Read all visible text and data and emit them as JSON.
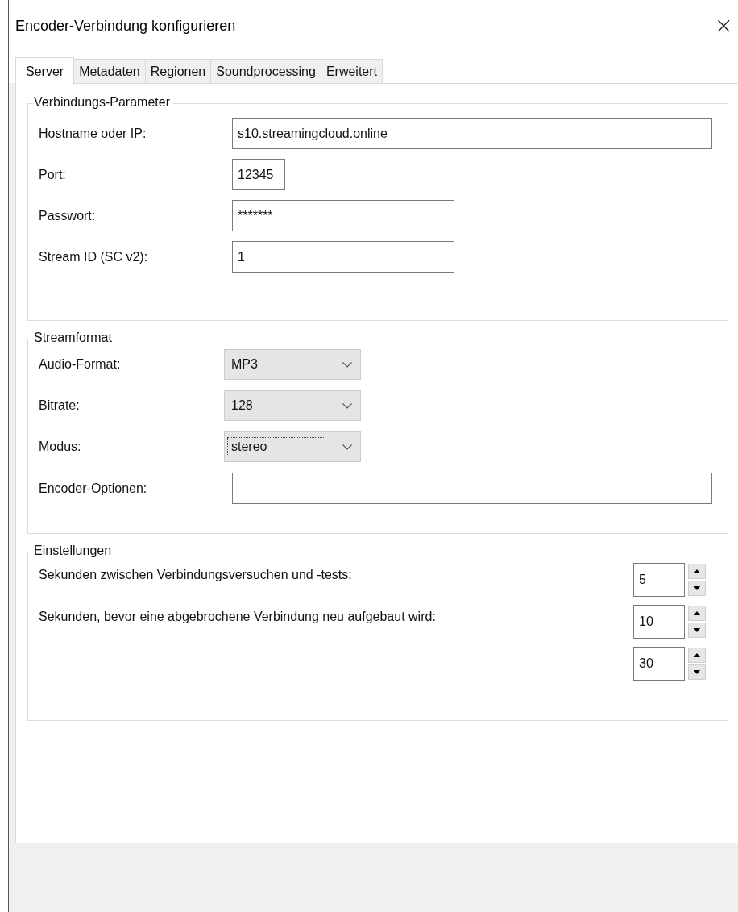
{
  "window": {
    "title": "Encoder-Verbindung konfigurieren",
    "close": "×"
  },
  "tabs": [
    {
      "label": "Server",
      "selected": true
    },
    {
      "label": "Metadaten",
      "selected": false
    },
    {
      "label": "Regionen",
      "selected": false
    },
    {
      "label": "Soundprocessing",
      "selected": false
    },
    {
      "label": "Erweitert",
      "selected": false
    }
  ],
  "groups": [
    {
      "title": "Verbindungs-Parameter",
      "rows": [
        {
          "kind": "wide",
          "label": "Hostname oder IP:",
          "value": "s10.streamingcloud.online"
        },
        {
          "kind": "short",
          "label": "Port:",
          "value": "12345"
        },
        {
          "kind": "text",
          "label": "Passwort:",
          "value": "*******"
        },
        {
          "kind": "text",
          "label": "Stream ID (SC v2):",
          "value": "1"
        }
      ]
    },
    {
      "title": "Streamformat",
      "rows": [
        {
          "kind": "combo",
          "label": "Audio-Format:",
          "value": "MP3",
          "focused": false
        },
        {
          "kind": "combo",
          "label": "Bitrate:",
          "value": "128",
          "focused": false
        },
        {
          "kind": "combo",
          "label": "Modus:",
          "value": "stereo",
          "focused": true
        },
        {
          "kind": "wide",
          "label": "Encoder-Optionen:"
        }
      ]
    },
    {
      "title": "Einstellungen",
      "rows": [
        {
          "kind": "spin",
          "label": "Sekunden zwischen Verbindungsversuchen und -tests:",
          "value": "5"
        },
        {
          "kind": "spin",
          "label": "Sekunden, bevor eine abgebrochene Verbindung neu aufgebaut wird:",
          "value": "10"
        },
        {
          "kind": "spin",
          "value": "30"
        }
      ]
    }
  ]
}
